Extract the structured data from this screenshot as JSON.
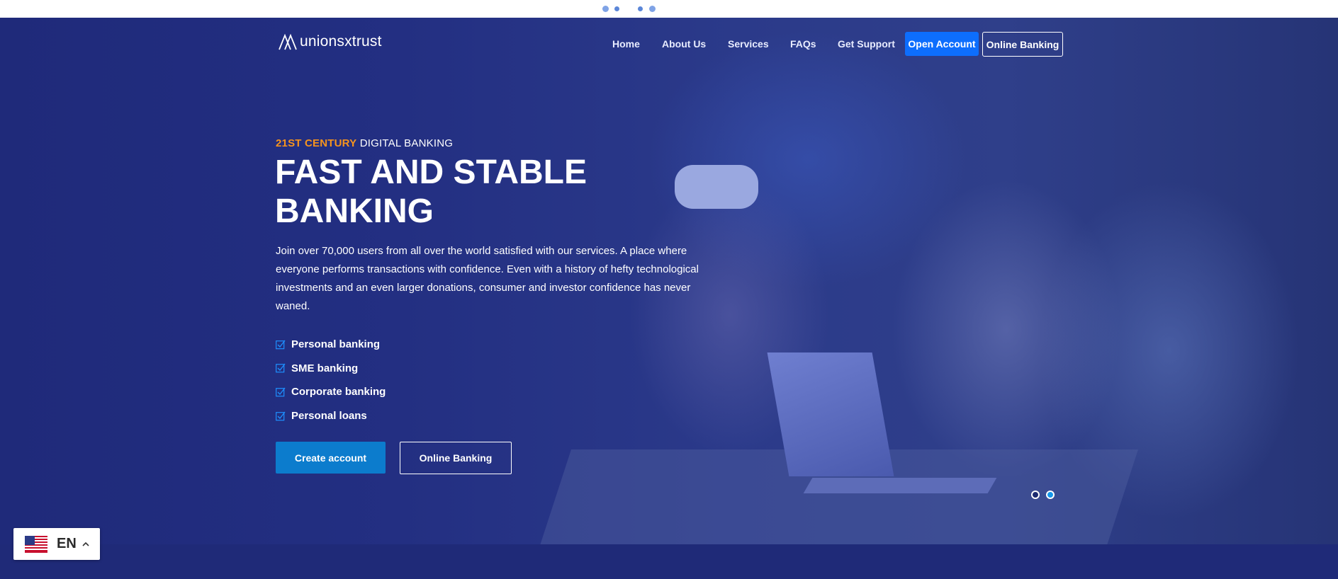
{
  "brand": {
    "logo_text": "unionsxtrust"
  },
  "nav": {
    "items": [
      "Home",
      "About Us",
      "Services",
      "FAQs",
      "Get Support"
    ],
    "open_account": "Open Account",
    "online_banking": "Online Banking"
  },
  "hero": {
    "kicker_accent": "21ST CENTURY",
    "kicker_rest": " DIGITAL BANKING",
    "headline": "FAST AND STABLE BANKING",
    "lede": "Join over 70,000 users from all over the world satisfied with our services. A place where everyone performs transactions with confidence. Even with a history of hefty technological investments and an even larger donations, consumer and investor confidence has never waned.",
    "features": [
      "Personal banking",
      "SME banking",
      "Corporate banking",
      "Personal loans"
    ],
    "cta_primary": "Create account",
    "cta_secondary": "Online Banking"
  },
  "slider": {
    "slide_count": 2,
    "active_slide": 2
  },
  "language": {
    "code": "EN",
    "flag_icon": "us-flag-icon"
  },
  "colors": {
    "hero_overlay": "#1f2a78",
    "accent_orange": "#f7941d",
    "primary_blue": "#0d6efd",
    "cta_blue": "#0c7ccd"
  }
}
